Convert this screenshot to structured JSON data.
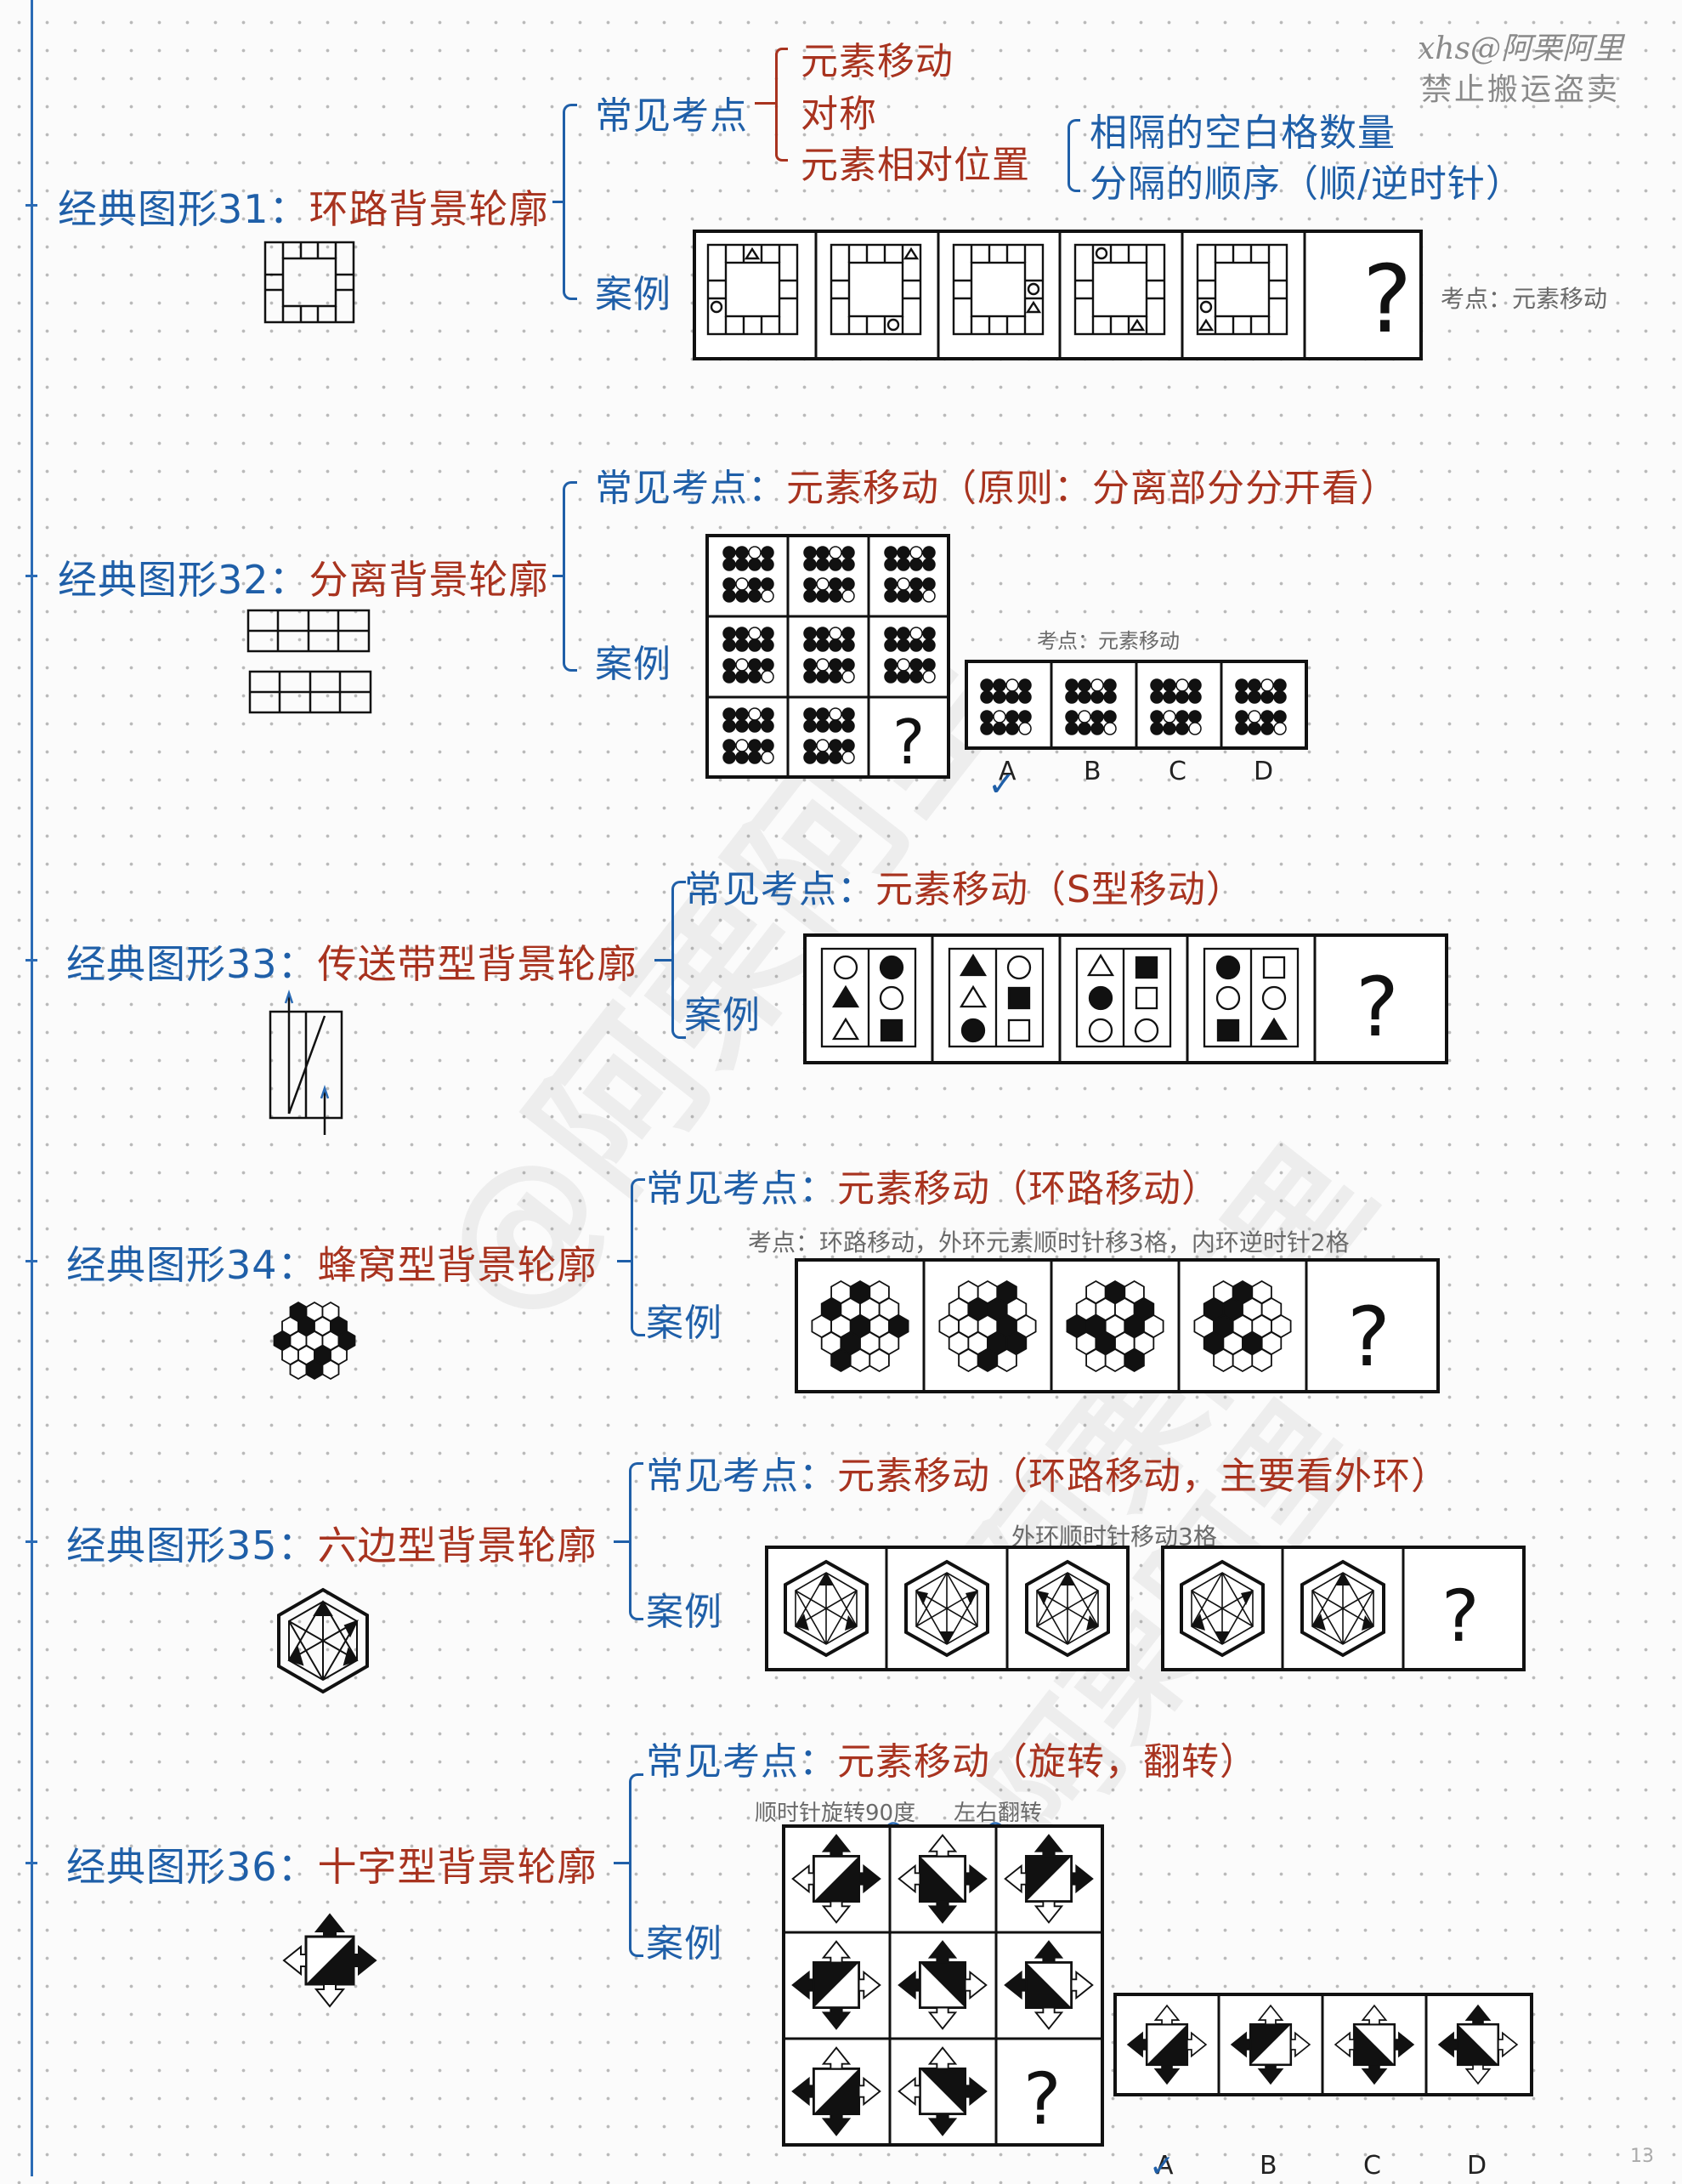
{
  "header": {
    "line1": "xhs@阿栗阿里",
    "line2": "禁止搬运盗卖"
  },
  "watermarks": [
    "@阿栗阿里",
    "阿栗阿里",
    "@阿栗阿里"
  ],
  "page_number": "13",
  "common_points_label": "常见考点",
  "case_label": "案例",
  "s31": {
    "title_prefix": "经典图形31：",
    "title_name": "环路背景轮廓",
    "points": [
      "元素移动",
      "对称",
      "元素相对位置"
    ],
    "subpoints": [
      "相隔的空白格数量",
      "分隔的顺序（顺/逆时针）"
    ],
    "note": "考点：元素移动"
  },
  "s32": {
    "title_prefix": "经典图形32：",
    "title_name": "分离背景轮廓",
    "points_label": "常见考点：",
    "points_value": "元素移动（原则：分离部分分开看）",
    "note": "考点：元素移动",
    "options": [
      "A",
      "B",
      "C",
      "D"
    ]
  },
  "s33": {
    "title_prefix": "经典图形33：",
    "title_name": "传送带型背景轮廓",
    "points_label": "常见考点：",
    "points_value": "元素移动（S型移动）"
  },
  "s34": {
    "title_prefix": "经典图形34：",
    "title_name": "蜂窝型背景轮廓",
    "points_label": "常见考点：",
    "points_value": "元素移动（环路移动）",
    "note": "考点：环路移动，外环元素顺时针移3格，内环逆时针2格"
  },
  "s35": {
    "title_prefix": "经典图形35：",
    "title_name": "六边型背景轮廓",
    "points_label": "常见考点：",
    "points_value": "元素移动（环路移动，主要看外环）",
    "note": "外环顺时针移动3格"
  },
  "s36": {
    "title_prefix": "经典图形36：",
    "title_name": "十字型背景轮廓",
    "points_label": "常见考点：",
    "points_value": "元素移动（旋转，翻转）",
    "note1": "顺时针旋转90度",
    "note2": "左右翻转",
    "options": [
      "A",
      "B",
      "C",
      "D"
    ]
  },
  "colors": {
    "blue": "#1f5fa8",
    "red": "#a8331f",
    "line": "#2b6bb5"
  }
}
